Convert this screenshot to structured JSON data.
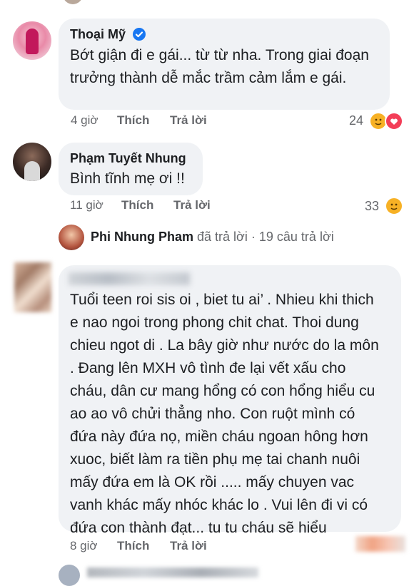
{
  "comments": [
    {
      "author": "Thoại Mỹ",
      "verified": true,
      "text": "Bớt giận đi e gái... từ từ nha. Trong giai đoạn trưởng thành dễ mắc trầm cảm lắm e gái.",
      "time": "4 giờ",
      "like_label": "Thích",
      "reply_label": "Trả lời",
      "reaction_count": "24",
      "reactions": [
        "care",
        "heart"
      ]
    },
    {
      "author": "Phạm Tuyết Nhung",
      "text": "Bình tĩnh mẹ ơi !!",
      "time": "11 giờ",
      "like_label": "Thích",
      "reply_label": "Trả lời",
      "reaction_count": "33",
      "reactions": [
        "care"
      ]
    },
    {
      "author": "",
      "text": "Tuổi teen roi sis oi , biet tu ai’ . Nhieu khi thich e nao ngoi trong phong chit chat. Thoi dung chieu ngot di . La bây giờ như nước do la môn . Đang lên MXH vô tình đe lại vết xấu cho cháu, dân cư mang hổng có con hổng hiểu cu ao ao vô chửi thẳng nho. Con ruột mình có đứa này đứa nọ, miền cháu ngoan hông hơn xuoc, biết làm ra tiền phụ mẹ tai chanh nuôi mấy đứa em là OK rồi ..... mấy chuyen vac vanh khác mấy nhóc khác lo . Vui lên đi vi có đứa con thành đạt... tu tu cháu sẽ hiểu",
      "time": "8 giờ",
      "like_label": "Thích",
      "reply_label": "Trả lời"
    }
  ],
  "reply_summary": {
    "author": "Phi Nhung Pham",
    "action": "đã trả lời",
    "separator": "·",
    "count_label": "19 câu trả lời"
  },
  "colors": {
    "bubble": "#f0f2f5",
    "meta_text": "#65676b",
    "like_blue": "#1877f2",
    "heart_red": "#f33e58",
    "care_yellow": "#f7b125"
  }
}
